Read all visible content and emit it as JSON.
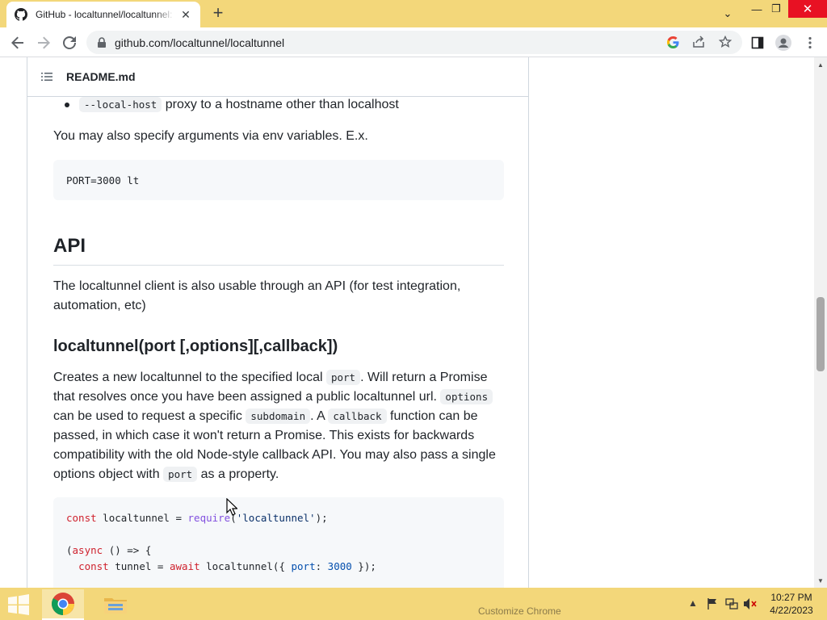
{
  "browser": {
    "tab_title": "GitHub - localtunnel/localtunnel:",
    "tab_close": "✕",
    "new_tab": "+",
    "url": "github.com/localtunnel/localtunnel",
    "window_minimize": "—",
    "window_restore": "❐",
    "window_close": "✕",
    "tab_search": "⌄"
  },
  "readme": {
    "filename": "README.md",
    "bullet_code": "--local-host",
    "bullet_text": "proxy to a hostname other than localhost",
    "env_para": "You may also specify arguments via env variables. E.x.",
    "env_code": "PORT=3000 lt",
    "api_heading": "API",
    "api_para": "The localtunnel client is also usable through an API (for test integration, automation, etc)",
    "fn_heading": "localtunnel(port [,options][,callback])",
    "desc": {
      "t1": "Creates a new localtunnel to the specified local ",
      "c1": "port",
      "t2": ". Will return a Promise that resolves once you have been assigned a public localtunnel url. ",
      "c2": "options",
      "t3": " can be used to request a specific ",
      "c3": "subdomain",
      "t4": ". A ",
      "c4": "callback",
      "t5": " function can be passed, in which case it won't return a Promise. This exists for backwards compatibility with the old Node-style callback API. You may also pass a single options object with ",
      "c5": "port",
      "t6": " as a property."
    },
    "code": {
      "l1_kw": "const",
      "l1_a": " localtunnel = ",
      "l1_fn": "require",
      "l1_b": "(",
      "l1_str": "'localtunnel'",
      "l1_c": ");",
      "l2_a": "(",
      "l2_kw": "async",
      "l2_b": " () => {",
      "l3_a": "  ",
      "l3_kw": "const",
      "l3_b": " tunnel = ",
      "l3_kw2": "await",
      "l3_c": " localtunnel({ ",
      "l3_prop": "port",
      "l3_d": ": ",
      "l3_num": "3000",
      "l3_e": " });"
    }
  },
  "taskbar": {
    "customize_chrome": "Customize Chrome",
    "time": "10:27 PM",
    "date": "4/22/2023"
  }
}
